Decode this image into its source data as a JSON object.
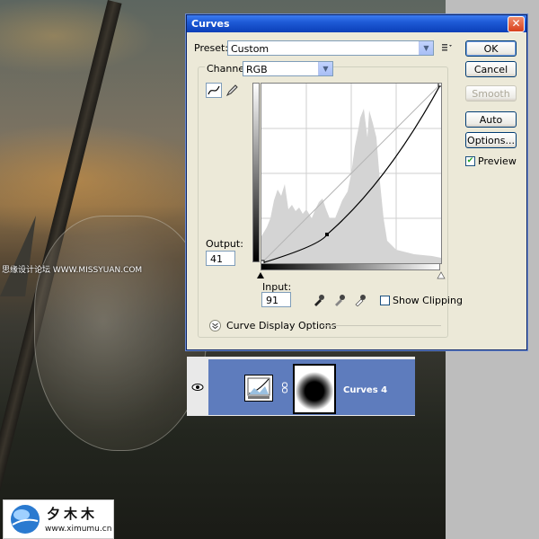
{
  "dialog": {
    "title": "Curves",
    "preset_label": "Preset:",
    "preset_value": "Custom",
    "channel_label": "Channel:",
    "channel_value": "RGB",
    "output_label": "Output:",
    "output_value": "41",
    "input_label": "Input:",
    "input_value": "91",
    "show_clipping_label": "Show Clipping",
    "curve_display_options_label": "Curve Display Options",
    "buttons": {
      "ok": "OK",
      "cancel": "Cancel",
      "smooth": "Smooth",
      "auto": "Auto",
      "options": "Options..."
    },
    "preview_label": "Preview",
    "preview_checked": true,
    "show_clipping_checked": false
  },
  "layers": {
    "layer_name": "Curves 4"
  },
  "watermark": {
    "left_text": "思缘设计论坛 WWW.MISSYUAN.COM",
    "logo_cn": "夕木木",
    "logo_url": "www.ximumu.cn"
  },
  "colors": {
    "titlebar": "#1e5ad6",
    "layer_selected": "#5e7cbd",
    "dialog_bg": "#ece9d8"
  }
}
